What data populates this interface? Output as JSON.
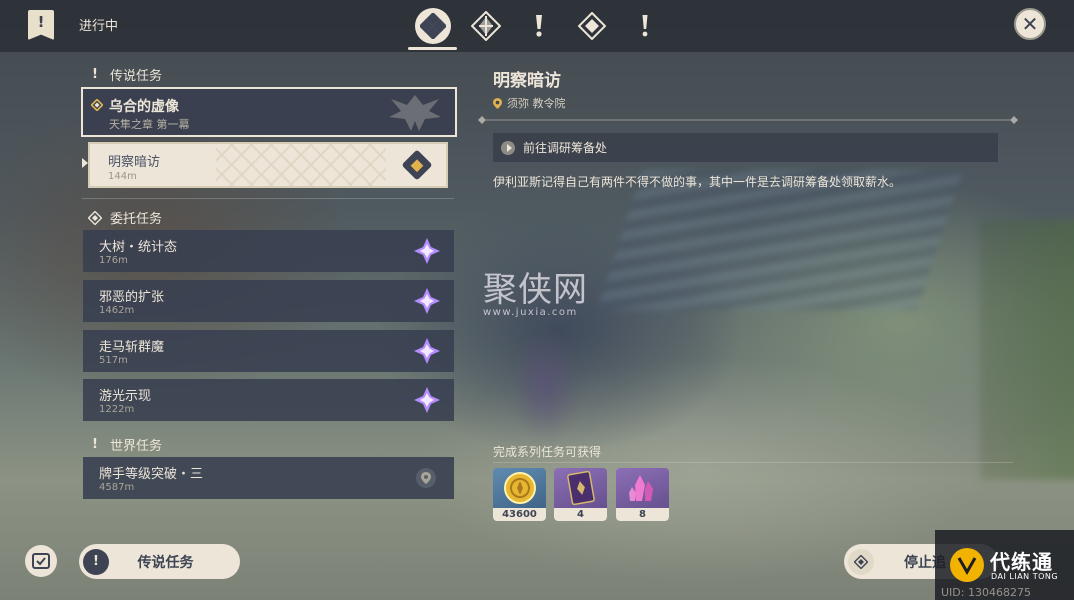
{
  "header": {
    "status_title": "进行中",
    "tabs": [
      {
        "icon": "all-quests-icon",
        "active": true
      },
      {
        "icon": "archon-quest-icon",
        "active": false
      },
      {
        "icon": "legend-quest-icon",
        "active": false
      },
      {
        "icon": "commission-quest-icon",
        "active": false
      },
      {
        "icon": "world-quest-icon",
        "active": false
      }
    ],
    "close_icon": "close-icon"
  },
  "quest_list": {
    "sections": [
      {
        "title": "传说任务",
        "icon": "legend-exclamation-icon",
        "selected_quest": {
          "title": "乌合的虚像",
          "subtitle": "天隼之章 第一幕",
          "icon": "legend-diamond-icon",
          "emblem": "falcon-emblem-icon"
        },
        "sub_quest": {
          "title": "明察暗访",
          "distance": "144m",
          "track_icon": "tracking-diamond-icon"
        }
      },
      {
        "title": "委托任务",
        "icon": "commission-diamond-icon",
        "items": [
          {
            "title": "大树・统计态",
            "distance": "176m"
          },
          {
            "title": "邪恶的扩张",
            "distance": "1462m"
          },
          {
            "title": "走马斩群魔",
            "distance": "517m"
          },
          {
            "title": "游光示现",
            "distance": "1222m"
          }
        ]
      },
      {
        "title": "世界任务",
        "icon": "world-exclamation-icon",
        "items": [
          {
            "title": "牌手等级突破・三",
            "distance": "4587m"
          }
        ]
      }
    ]
  },
  "detail": {
    "title": "明察暗访",
    "location": "须弥 教令院",
    "step": "前往调研筹备处",
    "description": "伊利亚斯记得自己有两件不得不做的事，其中一件是去调研筹备处领取薪水。",
    "rewards_title": "完成系列任务可获得",
    "rewards": [
      {
        "name": "mora-coin-icon",
        "qty": "43600",
        "rarity": "blue"
      },
      {
        "name": "hero-wit-book-icon",
        "qty": "4",
        "rarity": "purple"
      },
      {
        "name": "crystal-icon",
        "qty": "8",
        "rarity": "purple"
      }
    ]
  },
  "watermark": {
    "text": "聚侠网",
    "url": "www.juxia.com"
  },
  "bottom": {
    "legend_button": "传说任务",
    "stop_button": "停止追"
  },
  "badge": {
    "name": "代练通",
    "pinyin": "DAI LIAN TONG",
    "uid": "UID: 130468275"
  },
  "colors": {
    "panel": "#383e50",
    "cream": "#ece5d8",
    "gold": "#e0b34f",
    "commission_star": "#b48cff"
  }
}
